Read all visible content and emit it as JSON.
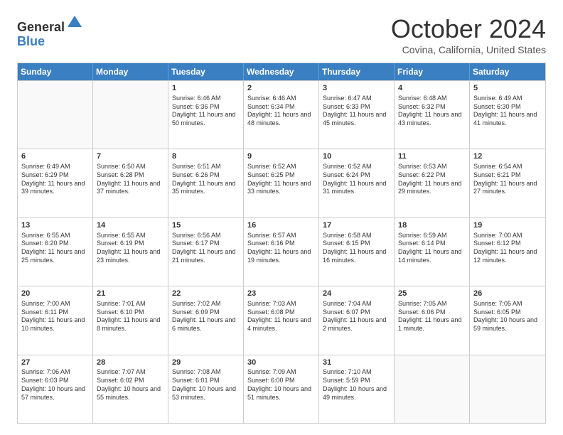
{
  "header": {
    "logo_line1": "General",
    "logo_line2": "Blue",
    "month": "October 2024",
    "location": "Covina, California, United States"
  },
  "days_of_week": [
    "Sunday",
    "Monday",
    "Tuesday",
    "Wednesday",
    "Thursday",
    "Friday",
    "Saturday"
  ],
  "weeks": [
    [
      {
        "day": "",
        "content": ""
      },
      {
        "day": "",
        "content": ""
      },
      {
        "day": "1",
        "content": "Sunrise: 6:46 AM\nSunset: 6:36 PM\nDaylight: 11 hours and 50 minutes."
      },
      {
        "day": "2",
        "content": "Sunrise: 6:46 AM\nSunset: 6:34 PM\nDaylight: 11 hours and 48 minutes."
      },
      {
        "day": "3",
        "content": "Sunrise: 6:47 AM\nSunset: 6:33 PM\nDaylight: 11 hours and 45 minutes."
      },
      {
        "day": "4",
        "content": "Sunrise: 6:48 AM\nSunset: 6:32 PM\nDaylight: 11 hours and 43 minutes."
      },
      {
        "day": "5",
        "content": "Sunrise: 6:49 AM\nSunset: 6:30 PM\nDaylight: 11 hours and 41 minutes."
      }
    ],
    [
      {
        "day": "6",
        "content": "Sunrise: 6:49 AM\nSunset: 6:29 PM\nDaylight: 11 hours and 39 minutes."
      },
      {
        "day": "7",
        "content": "Sunrise: 6:50 AM\nSunset: 6:28 PM\nDaylight: 11 hours and 37 minutes."
      },
      {
        "day": "8",
        "content": "Sunrise: 6:51 AM\nSunset: 6:26 PM\nDaylight: 11 hours and 35 minutes."
      },
      {
        "day": "9",
        "content": "Sunrise: 6:52 AM\nSunset: 6:25 PM\nDaylight: 11 hours and 33 minutes."
      },
      {
        "day": "10",
        "content": "Sunrise: 6:52 AM\nSunset: 6:24 PM\nDaylight: 11 hours and 31 minutes."
      },
      {
        "day": "11",
        "content": "Sunrise: 6:53 AM\nSunset: 6:22 PM\nDaylight: 11 hours and 29 minutes."
      },
      {
        "day": "12",
        "content": "Sunrise: 6:54 AM\nSunset: 6:21 PM\nDaylight: 11 hours and 27 minutes."
      }
    ],
    [
      {
        "day": "13",
        "content": "Sunrise: 6:55 AM\nSunset: 6:20 PM\nDaylight: 11 hours and 25 minutes."
      },
      {
        "day": "14",
        "content": "Sunrise: 6:55 AM\nSunset: 6:19 PM\nDaylight: 11 hours and 23 minutes."
      },
      {
        "day": "15",
        "content": "Sunrise: 6:56 AM\nSunset: 6:17 PM\nDaylight: 11 hours and 21 minutes."
      },
      {
        "day": "16",
        "content": "Sunrise: 6:57 AM\nSunset: 6:16 PM\nDaylight: 11 hours and 19 minutes."
      },
      {
        "day": "17",
        "content": "Sunrise: 6:58 AM\nSunset: 6:15 PM\nDaylight: 11 hours and 16 minutes."
      },
      {
        "day": "18",
        "content": "Sunrise: 6:59 AM\nSunset: 6:14 PM\nDaylight: 11 hours and 14 minutes."
      },
      {
        "day": "19",
        "content": "Sunrise: 7:00 AM\nSunset: 6:12 PM\nDaylight: 11 hours and 12 minutes."
      }
    ],
    [
      {
        "day": "20",
        "content": "Sunrise: 7:00 AM\nSunset: 6:11 PM\nDaylight: 11 hours and 10 minutes."
      },
      {
        "day": "21",
        "content": "Sunrise: 7:01 AM\nSunset: 6:10 PM\nDaylight: 11 hours and 8 minutes."
      },
      {
        "day": "22",
        "content": "Sunrise: 7:02 AM\nSunset: 6:09 PM\nDaylight: 11 hours and 6 minutes."
      },
      {
        "day": "23",
        "content": "Sunrise: 7:03 AM\nSunset: 6:08 PM\nDaylight: 11 hours and 4 minutes."
      },
      {
        "day": "24",
        "content": "Sunrise: 7:04 AM\nSunset: 6:07 PM\nDaylight: 11 hours and 2 minutes."
      },
      {
        "day": "25",
        "content": "Sunrise: 7:05 AM\nSunset: 6:06 PM\nDaylight: 11 hours and 1 minute."
      },
      {
        "day": "26",
        "content": "Sunrise: 7:05 AM\nSunset: 6:05 PM\nDaylight: 10 hours and 59 minutes."
      }
    ],
    [
      {
        "day": "27",
        "content": "Sunrise: 7:06 AM\nSunset: 6:03 PM\nDaylight: 10 hours and 57 minutes."
      },
      {
        "day": "28",
        "content": "Sunrise: 7:07 AM\nSunset: 6:02 PM\nDaylight: 10 hours and 55 minutes."
      },
      {
        "day": "29",
        "content": "Sunrise: 7:08 AM\nSunset: 6:01 PM\nDaylight: 10 hours and 53 minutes."
      },
      {
        "day": "30",
        "content": "Sunrise: 7:09 AM\nSunset: 6:00 PM\nDaylight: 10 hours and 51 minutes."
      },
      {
        "day": "31",
        "content": "Sunrise: 7:10 AM\nSunset: 5:59 PM\nDaylight: 10 hours and 49 minutes."
      },
      {
        "day": "",
        "content": ""
      },
      {
        "day": "",
        "content": ""
      }
    ]
  ]
}
